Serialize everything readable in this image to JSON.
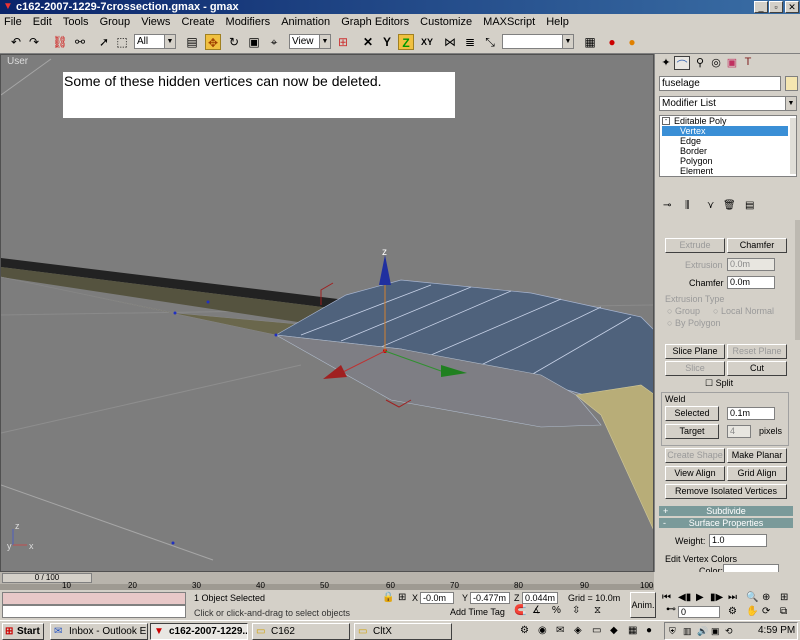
{
  "window": {
    "title": "c162-2007-1229-7crossection.gmax - gmax",
    "controls": [
      "_",
      "▫",
      "✕"
    ]
  },
  "menu": [
    "File",
    "Edit",
    "Tools",
    "Group",
    "Views",
    "Create",
    "Modifiers",
    "Animation",
    "Graph Editors",
    "Customize",
    "MAXScript",
    "Help"
  ],
  "toolbar": {
    "selection_filter": "All",
    "ref_coord": "View",
    "axis_z": "Z",
    "axis_xy": "XY",
    "named_selection": ""
  },
  "viewport": {
    "label": "User",
    "note": "Some of these hidden vertices can now be deleted.",
    "gizmo_z": "z",
    "axis_tripod": {
      "y": "y",
      "z": "z",
      "x": "x"
    }
  },
  "command_panel": {
    "object_name": "fuselage",
    "modifier_list": "Modifier List",
    "stack": {
      "root": "Editable Poly",
      "items": [
        "Vertex",
        "Edge",
        "Border",
        "Polygon",
        "Element"
      ],
      "selected": "Vertex"
    },
    "edit_geometry": {
      "extrude": "Extrude",
      "chamfer_btn": "Chamfer",
      "extrusion_label": "Extrusion",
      "extrusion_value": "0.0m",
      "chamfer_label": "Chamfer",
      "chamfer_value": "0.0m",
      "extrusion_type": "Extrusion Type",
      "group": "Group",
      "local_normal": "Local Normal",
      "by_polygon": "By Polygon",
      "slice_plane": "Slice Plane",
      "reset_plane": "Reset Plane",
      "slice": "Slice",
      "cut": "Cut",
      "split": "Split",
      "weld": "Weld",
      "selected": "Selected",
      "selected_value": "0.1m",
      "target": "Target",
      "target_value": "4",
      "pixels": "pixels",
      "create_shape": "Create Shape",
      "make_planar": "Make Planar",
      "view_align": "View Align",
      "grid_align": "Grid Align",
      "remove_isolated": "Remove Isolated Vertices"
    },
    "subdivide": {
      "sign": "+",
      "label": "Subdivide"
    },
    "surface": {
      "sign": "-",
      "label": "Surface Properties",
      "weight_label": "Weight:",
      "weight_value": "1.0",
      "edit_vertex_colors": "Edit Vertex Colors",
      "color": "Color:"
    }
  },
  "timeline": {
    "slider": "0 / 100",
    "ticks": [
      "10",
      "20",
      "30",
      "40",
      "50",
      "60",
      "70",
      "80",
      "90",
      "100"
    ]
  },
  "status": {
    "selection": "1 Object Selected",
    "prompt": "Click or click-and-drag to select objects",
    "x_label": "X",
    "x": "-0.0m",
    "y_label": "Y",
    "y": "-0.477m",
    "z_label": "Z",
    "z": "0.044m",
    "grid": "Grid = 10.0m",
    "add_time_tag": "Add Time Tag",
    "anim": "Anim.",
    "frame": "0"
  },
  "taskbar": {
    "start": "Start",
    "tasks": [
      "Inbox - Outlook E...",
      "c162-2007-1229...",
      "C162",
      "CltX"
    ],
    "active_index": 1,
    "clock": "4:59 PM"
  },
  "colors": {
    "titlebar": "#0a246a",
    "viewport_bg": "#7d7d7d",
    "selected_item": "#3a8fd6",
    "rollout_header": "#7a9a9a"
  }
}
